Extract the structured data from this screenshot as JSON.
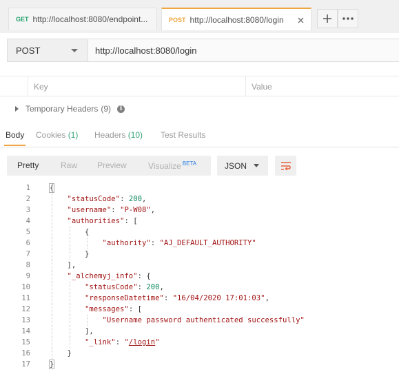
{
  "tabs": [
    {
      "method": "GET",
      "method_color": "#23a26d",
      "url": "http://localhost:8080/endpoint..."
    },
    {
      "method": "POST",
      "method_color": "#f0a640",
      "url": "http://localhost:8080/login"
    }
  ],
  "tab_close_icon": "close-icon",
  "tab_add_icon": "plus-icon",
  "tab_more_icon": "ellipsis-icon",
  "request": {
    "method": "POST",
    "url": "http://localhost:8080/login"
  },
  "headers_table": {
    "columns": [
      "Key",
      "Value"
    ]
  },
  "temporary_headers": {
    "label": "Temporary Headers",
    "count": "(9)"
  },
  "response_tabs": [
    {
      "label": "Body",
      "count": ""
    },
    {
      "label": "Cookies",
      "count": "(1)"
    },
    {
      "label": "Headers",
      "count": "(10)"
    },
    {
      "label": "Test Results",
      "count": ""
    }
  ],
  "view_modes": [
    "Pretty",
    "Raw",
    "Preview",
    "Visualize"
  ],
  "visualize_badge": "BETA",
  "format": "JSON",
  "wrap_icon": "wrap-lines-icon",
  "accent_color": "#f0a640",
  "code_lines": [
    "{",
    "    \"statusCode\": 200,",
    "    \"username\": \"P-W08\",",
    "    \"authorities\": [",
    "        {",
    "            \"authority\": \"AJ_DEFAULT_AUTHORITY\"",
    "        }",
    "    ],",
    "    \"_alchemyj_info\": {",
    "        \"statusCode\": 200,",
    "        \"responseDatetime\": \"16/04/2020 17:01:03\",",
    "        \"messages\": [",
    "            \"Username password authenticated successfully\"",
    "        ],",
    "        \"_link\": \"/login\"",
    "    }",
    "}"
  ]
}
